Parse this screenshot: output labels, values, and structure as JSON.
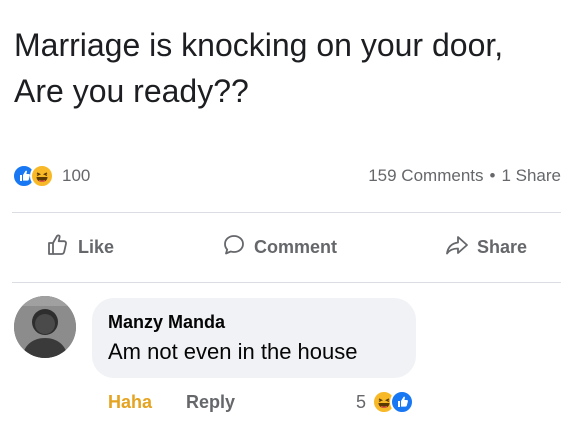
{
  "post": {
    "text": "Marriage is knocking on your door, Are you ready??"
  },
  "stats": {
    "reaction_count": "100",
    "comments": "159 Comments",
    "separator": "•",
    "shares": "1 Share",
    "reaction_icons": [
      "like-icon",
      "haha-icon"
    ]
  },
  "actions": {
    "like_label": "Like",
    "comment_label": "Comment",
    "share_label": "Share"
  },
  "comment": {
    "author": "Manzy Manda",
    "text": "Am not even in the house",
    "haha_label": "Haha",
    "reply_label": "Reply",
    "reaction_count": "5",
    "reaction_icons": [
      "haha-icon",
      "like-icon"
    ]
  },
  "colors": {
    "like_blue": "#1877f2",
    "haha_yellow": "#f7b928",
    "haha_text": "#e4a320",
    "muted": "#65676b",
    "bubble_bg": "#f0f2f5"
  }
}
